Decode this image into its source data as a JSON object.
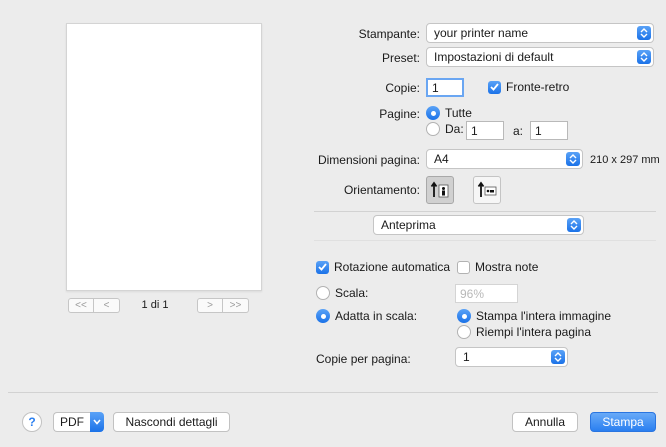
{
  "preview": {
    "page_indicator": "1 di 1",
    "first_glyph": "<<",
    "prev_glyph": "<",
    "next_glyph": ">",
    "last_glyph": ">>"
  },
  "printer": {
    "label": "Stampante:",
    "value": "your printer name"
  },
  "preset": {
    "label": "Preset:",
    "value": "Impostazioni di default"
  },
  "copies": {
    "label": "Copie:",
    "value": "1",
    "duplex_label": "Fronte-retro",
    "duplex_checked": true
  },
  "pages": {
    "label": "Pagine:",
    "all_label": "Tutte",
    "range_from_label": "Da:",
    "range_from_value": "1",
    "range_to_label": "a:",
    "range_to_value": "1"
  },
  "paper_size": {
    "label": "Dimensioni pagina:",
    "value": "A4",
    "dimensions": "210 x 297 mm"
  },
  "orientation": {
    "label": "Orientamento:",
    "selected": "portrait"
  },
  "section_popup": {
    "value": "Anteprima"
  },
  "options": {
    "auto_rotate_label": "Rotazione automatica",
    "auto_rotate_checked": true,
    "show_notes_label": "Mostra note",
    "show_notes_checked": false,
    "scale_label": "Scala:",
    "scale_value": "96%",
    "fit_label": "Adatta in scala:",
    "print_entire_label": "Stampa l'intera immagine",
    "fill_page_label": "Riempi l'intera pagina",
    "copies_per_page_label": "Copie per pagina:",
    "copies_per_page_value": "1"
  },
  "footer": {
    "help_glyph": "?",
    "pdf_label": "PDF",
    "hide_details_label": "Nascondi dettagli",
    "cancel_label": "Annulla",
    "print_label": "Stampa"
  },
  "colors": {
    "accent": "#2a7ff0",
    "background": "#ececec"
  }
}
